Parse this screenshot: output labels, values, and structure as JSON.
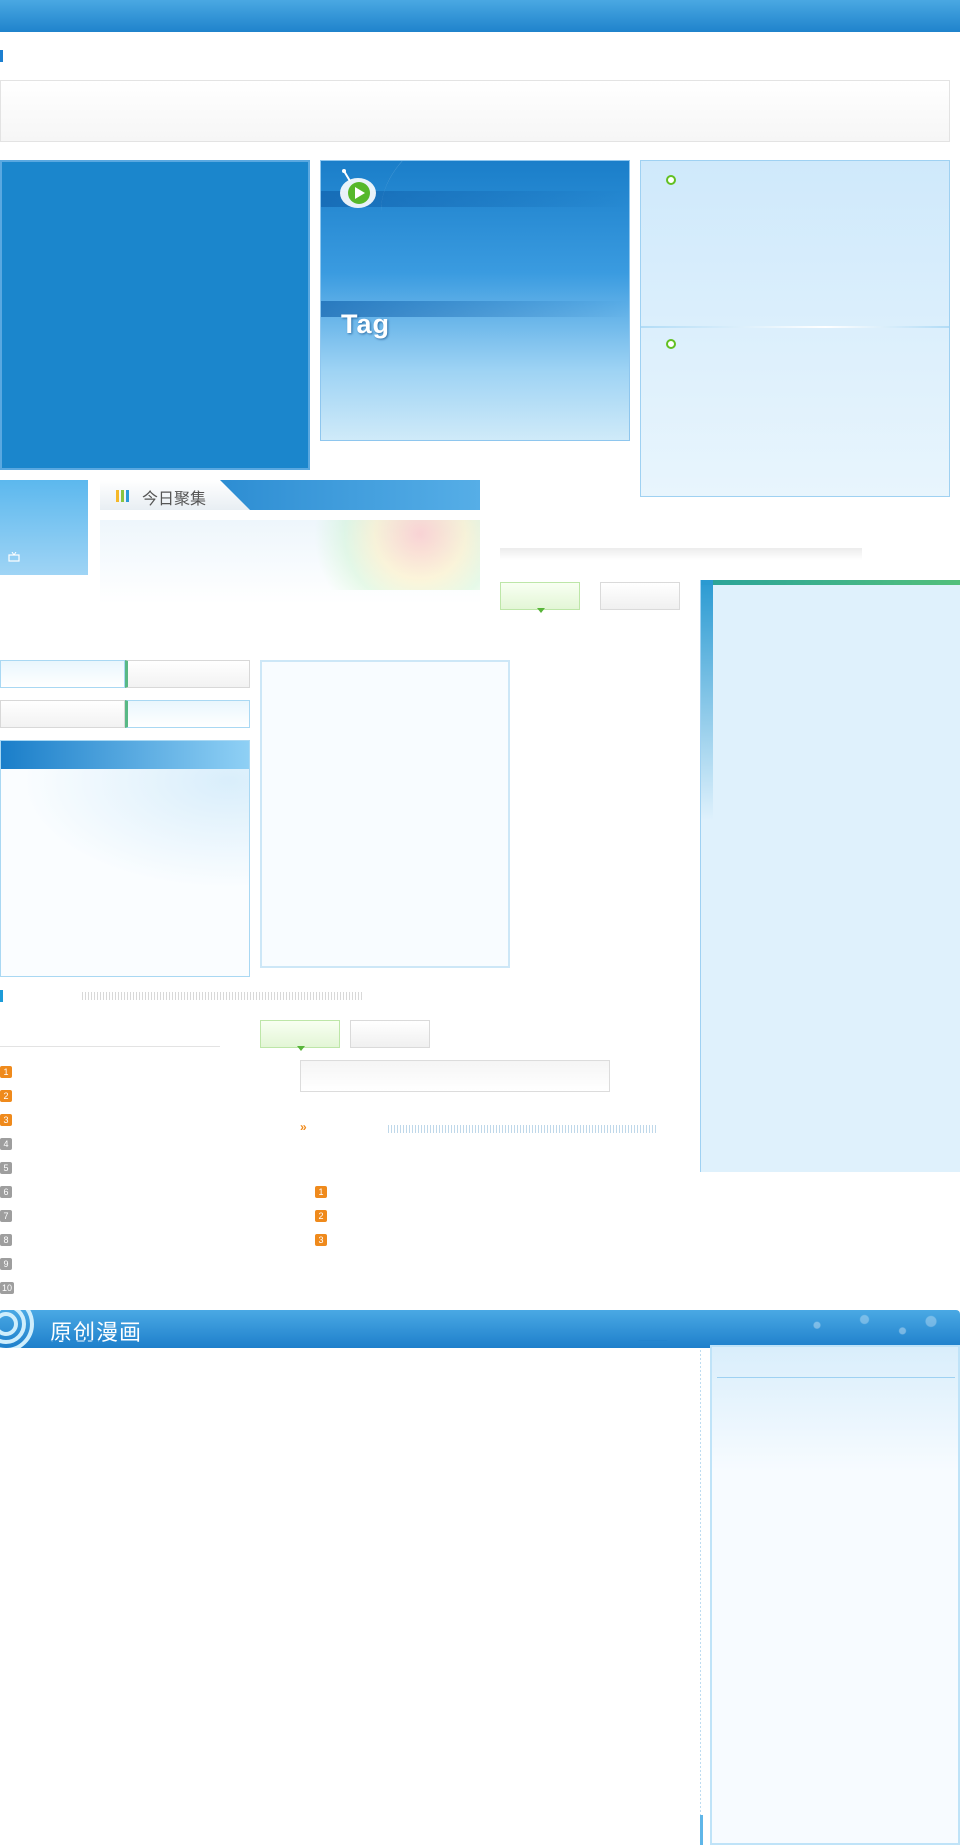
{
  "hero": {
    "tag_label": "Tag"
  },
  "focus": {
    "title": "今日聚集",
    "bar_colors": [
      "#f5b829",
      "#8ac43f",
      "#2b9ad8"
    ]
  },
  "ranking": {
    "hot_numbers": [
      "1",
      "2",
      "3"
    ],
    "cold_numbers": [
      "4",
      "5",
      "6",
      "7",
      "8",
      "9",
      "10"
    ],
    "sub_numbers": [
      "1",
      "2",
      "3"
    ],
    "more_symbol": "»"
  },
  "comics": {
    "section_title": "原创漫画"
  },
  "colors": {
    "primary_blue": "#1f83cc",
    "accent_orange": "#ef8a1c",
    "accent_green": "#58b53a"
  }
}
